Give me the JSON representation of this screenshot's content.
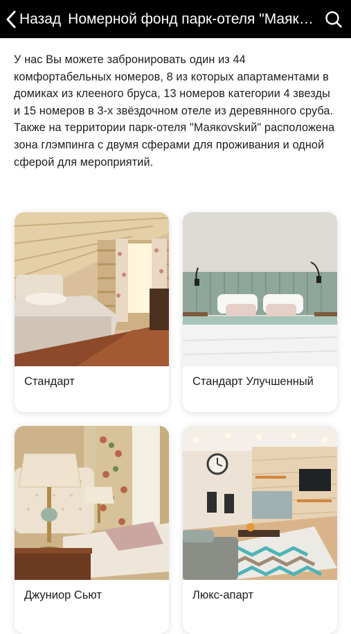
{
  "header": {
    "back_label": "Назад",
    "title": "Номерной фонд парк-отеля \"Маяковский\"",
    "icons": {
      "back": "chevron-left-icon",
      "search": "search-icon"
    },
    "background_color": "#000000",
    "text_color": "#ffffff"
  },
  "intro": {
    "text": "У нас Вы можете забронировать один из 44 комфортабельных номеров, 8 из которых апартаментами в домиках из клееного бруса, 13 номеров категории 4 звезды и 15 номеров в 3-х звёздочном отеле из деревянного сруба. Также на территории парк-отеля \"Маякоvskий\" расположена зона глэмпинга с двумя сферами для проживания и одной сферой для мероприятий."
  },
  "rooms": [
    {
      "name": "Стандарт",
      "photo": "standard-room-photo"
    },
    {
      "name": "Стандарт Улучшенный",
      "photo": "standard-improved-room-photo"
    },
    {
      "name": "Джуниор Сьют",
      "photo": "junior-suite-photo"
    },
    {
      "name": "Люкс-апарт",
      "photo": "lux-apart-photo"
    }
  ]
}
